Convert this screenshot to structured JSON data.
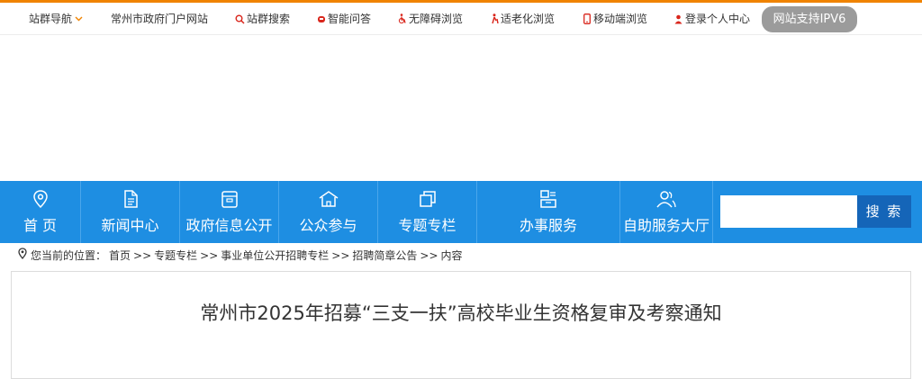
{
  "topbar": {
    "site_nav": "站群导航",
    "portal": "常州市政府门户网站",
    "search": "站群搜索",
    "qa": "智能问答",
    "accessible": "无障碍浏览",
    "elderly": "适老化浏览",
    "mobile": "移动端浏览",
    "login": "登录个人中心",
    "ipv6": "网站支持IPV6"
  },
  "nav": {
    "items": [
      {
        "label": "首 页",
        "icon": "location-pin-icon"
      },
      {
        "label": "新闻中心",
        "icon": "document-icon"
      },
      {
        "label": "政府信息公开",
        "icon": "folder-icon"
      },
      {
        "label": "公众参与",
        "icon": "house-icon"
      },
      {
        "label": "专题专栏",
        "icon": "copy-icon"
      },
      {
        "label": "办事服务",
        "icon": "service-icon"
      },
      {
        "label": "自助服务大厅",
        "icon": "users-icon"
      }
    ],
    "search_button": "搜 索"
  },
  "breadcrumb": {
    "prefix": "您当前的位置：",
    "items": [
      "首页",
      "专题专栏",
      "事业单位公开招聘专栏",
      "招聘简章公告",
      "内容"
    ],
    "separator": ">>"
  },
  "article": {
    "title": "常州市2025年招募“三支一扶”高校毕业生资格复审及考察通知"
  },
  "colors": {
    "accent_orange": "#f08300",
    "nav_blue": "#1e8ee2",
    "search_blue": "#1565b8",
    "ipv6_gray": "#9b9b9b"
  }
}
